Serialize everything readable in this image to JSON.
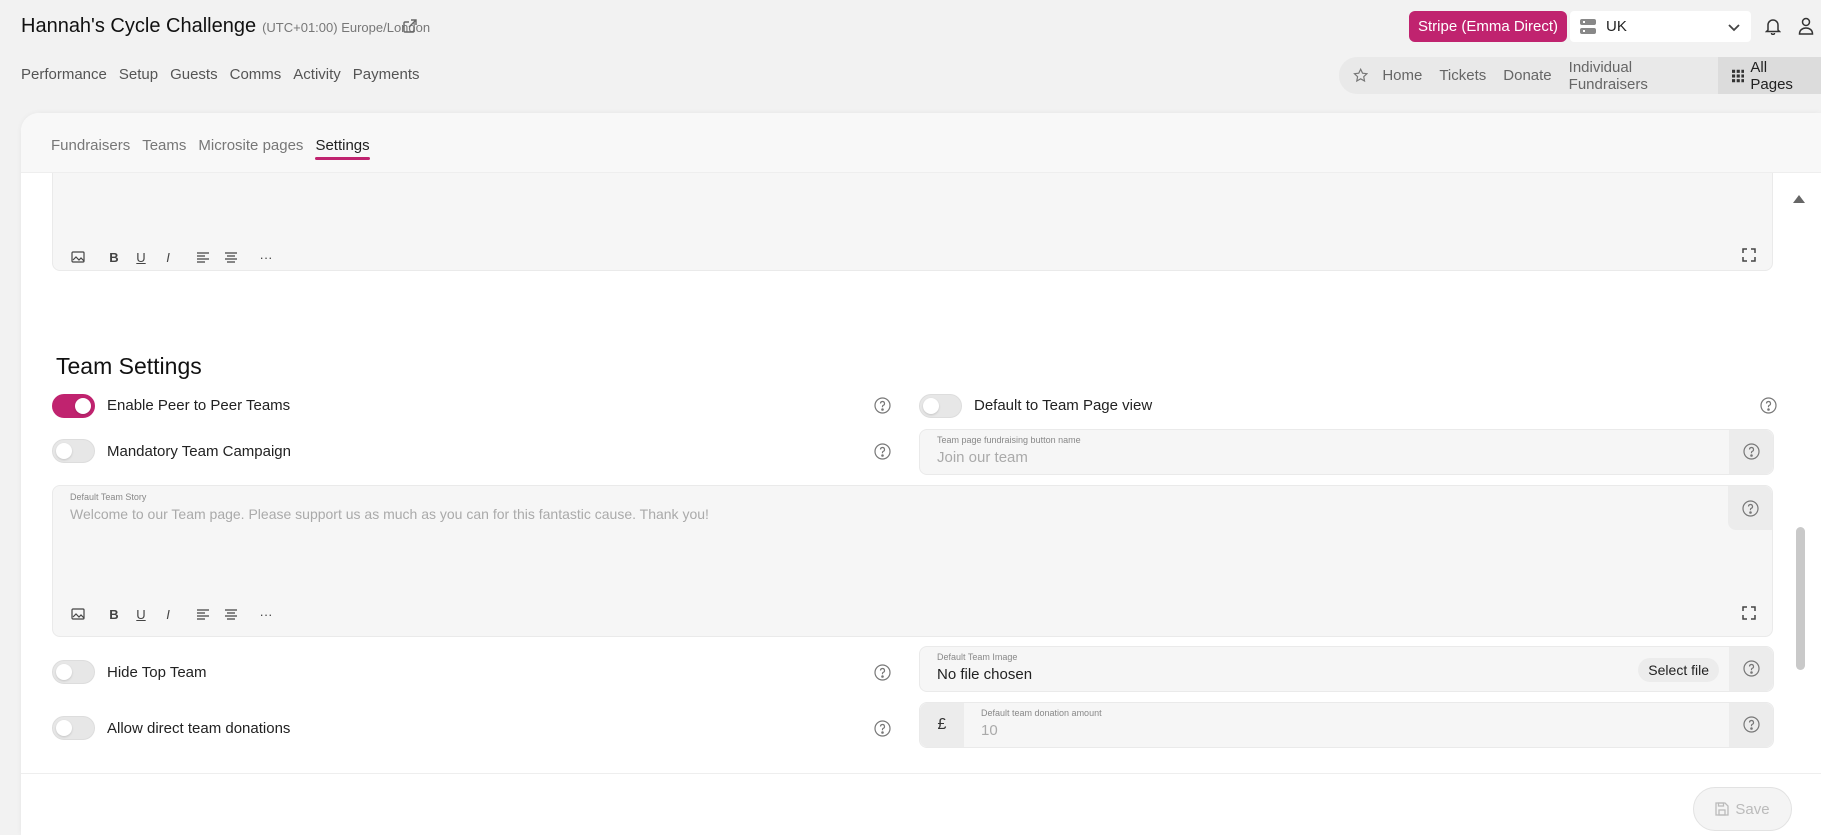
{
  "header": {
    "title": "Hannah's Cycle Challenge",
    "timezone": "(UTC+01:00) Europe/London",
    "stripe_label": "Stripe (Emma Direct)",
    "region": "UK"
  },
  "main_nav": [
    "Performance",
    "Setup",
    "Guests",
    "Comms",
    "Activity",
    "Payments"
  ],
  "pages_nav": {
    "items": [
      "Home",
      "Tickets",
      "Donate",
      "Individual Fundraisers"
    ],
    "all_pages": "All Pages"
  },
  "tabs": [
    "Fundraisers",
    "Teams",
    "Microsite pages",
    "Settings"
  ],
  "active_tab": "Settings",
  "team_settings": {
    "title": "Team Settings",
    "enable_p2p": "Enable Peer to Peer Teams",
    "default_team_view": "Default to Team Page view",
    "mandatory_campaign": "Mandatory Team Campaign",
    "button_name_label": "Team page fundraising button name",
    "button_name_placeholder": "Join our team",
    "story_label": "Default Team Story",
    "story_placeholder": "Welcome to our Team page. Please support us as much as you can for this fantastic cause. Thank you!",
    "hide_top_team": "Hide Top Team",
    "image_label": "Default Team Image",
    "image_value": "No file chosen",
    "select_file": "Select file",
    "allow_direct": "Allow direct team donations",
    "currency_symbol": "£",
    "donation_label": "Default team donation amount",
    "donation_placeholder": "10"
  },
  "toggles": {
    "enable_p2p": true,
    "default_team_view": false,
    "mandatory_campaign": false,
    "hide_top_team": false,
    "allow_direct": false
  },
  "save_label": "Save",
  "colors": {
    "accent": "#c0236f"
  }
}
